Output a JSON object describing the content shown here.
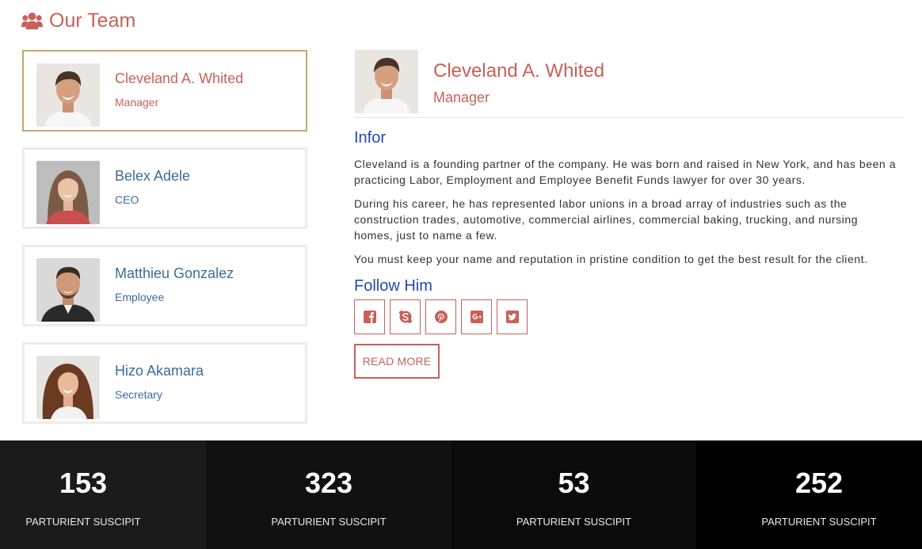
{
  "section": {
    "title": "Our Team",
    "icon": "users-icon"
  },
  "members": [
    {
      "name": "Cleveland A. Whited",
      "role": "Manager",
      "active": true
    },
    {
      "name": "Belex Adele",
      "role": "CEO",
      "active": false
    },
    {
      "name": "Matthieu Gonzalez",
      "role": "Employee",
      "active": false
    },
    {
      "name": "Hizo Akamara",
      "role": "Secretary",
      "active": false
    }
  ],
  "detail": {
    "name": "Cleveland A. Whited",
    "role": "Manager",
    "info_heading": "Infor",
    "bio": [
      "Cleveland is a founding partner of the company. He was born and raised in New York, and has been a practicing Labor, Employment and Employee Benefit Funds lawyer for over 30 years.",
      "During his career, he has represented labor unions in a broad array of industries such as the construction trades, automotive, commercial airlines, commercial baking, trucking, and nursing homes, just to name a few.",
      "You must keep your name and reputation in pristine condition to get the best result for the client."
    ],
    "follow_heading": "Follow Him",
    "socials": [
      "facebook-icon",
      "skype-icon",
      "pinterest-icon",
      "google-plus-icon",
      "twitter-icon"
    ],
    "read_more": "READ MORE"
  },
  "stats": [
    {
      "value": "153",
      "label": "PARTURIENT SUSCIPIT"
    },
    {
      "value": "323",
      "label": "PARTURIENT SUSCIPIT"
    },
    {
      "value": "53",
      "label": "PARTURIENT SUSCIPIT"
    },
    {
      "value": "252",
      "label": "PARTURIENT SUSCIPIT"
    }
  ],
  "colors": {
    "accent": "#c9605a",
    "link": "#3a6d98",
    "heading_blue": "#2448b8",
    "active_border": "#c0a86a",
    "stat_backgrounds": [
      "#1b1b1b",
      "#111111",
      "#0b0b0b",
      "#000000"
    ]
  }
}
